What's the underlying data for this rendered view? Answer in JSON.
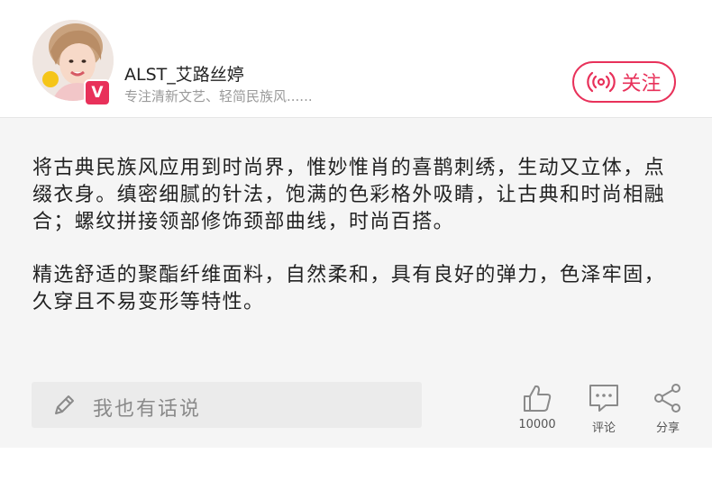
{
  "author": {
    "username": "ALST_艾路丝婷",
    "bio": "专注清新文艺、轻简民族风......",
    "badge": "V"
  },
  "follow": {
    "label": "关注"
  },
  "post": {
    "paragraphs": [
      "将古典民族风应用到时尚界，惟妙惟肖的喜鹊刺绣，生动又立体，点缀衣身。缜密细腻的针法，饱满的色彩格外吸睛，让古典和时尚相融合；螺纹拼接领部修饰颈部曲线，时尚百搭。",
      "精选舒适的聚酯纤维面料，自然柔和，具有良好的弹力，色泽牢固，久穿且不易变形等特性。"
    ]
  },
  "comment_box": {
    "placeholder": "我也有话说"
  },
  "actions": {
    "like_count": "10000",
    "comment_label": "评论",
    "share_label": "分享"
  },
  "colors": {
    "accent": "#e8315a",
    "content_bg": "#f5f5f5",
    "icon_gray": "#8a8a8a"
  }
}
